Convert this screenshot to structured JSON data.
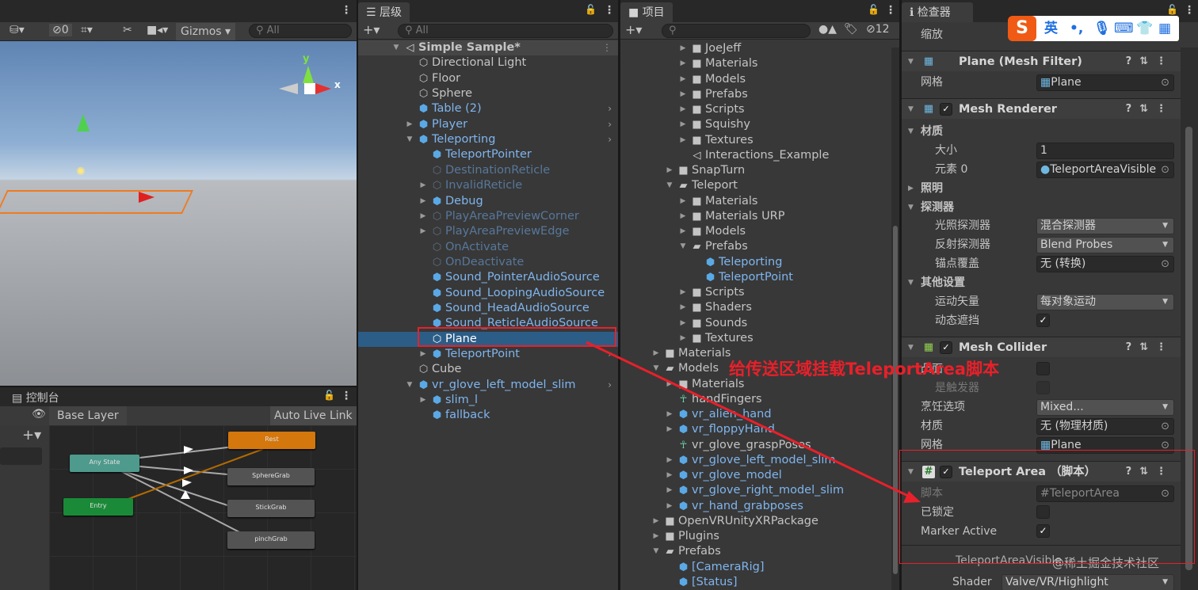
{
  "scene": {
    "hidden_count": "0",
    "gizmos": "Gizmos",
    "search_placeholder": "All",
    "axis_x": "x",
    "axis_y": "y"
  },
  "hierarchy": {
    "tab": "层级",
    "search_placeholder": "All",
    "rows": [
      {
        "label": "Simple Sample*",
        "depth": 0,
        "arrow": "down",
        "type": "scene",
        "bold": true,
        "menu": true
      },
      {
        "label": "Directional Light",
        "depth": 1,
        "type": "go"
      },
      {
        "label": "Floor",
        "depth": 1,
        "type": "go"
      },
      {
        "label": "Sphere",
        "depth": 1,
        "type": "go"
      },
      {
        "label": "Table (2)",
        "depth": 1,
        "type": "prefab",
        "chev": true
      },
      {
        "label": "Player",
        "depth": 1,
        "arrow": "right",
        "type": "prefab",
        "chev": true
      },
      {
        "label": "Teleporting",
        "depth": 1,
        "arrow": "down",
        "type": "prefab",
        "chev": true
      },
      {
        "label": "TeleportPointer",
        "depth": 2,
        "type": "prefab"
      },
      {
        "label": "DestinationReticle",
        "depth": 2,
        "type": "inactive"
      },
      {
        "label": "InvalidReticle",
        "depth": 2,
        "arrow": "right",
        "type": "inactive"
      },
      {
        "label": "Debug",
        "depth": 2,
        "arrow": "right",
        "type": "prefab"
      },
      {
        "label": "PlayAreaPreviewCorner",
        "depth": 2,
        "arrow": "right",
        "type": "inactive"
      },
      {
        "label": "PlayAreaPreviewEdge",
        "depth": 2,
        "arrow": "right",
        "type": "inactive"
      },
      {
        "label": "OnActivate",
        "depth": 2,
        "type": "inactive"
      },
      {
        "label": "OnDeactivate",
        "depth": 2,
        "type": "inactive"
      },
      {
        "label": "Sound_PointerAudioSource",
        "depth": 2,
        "type": "prefab"
      },
      {
        "label": "Sound_LoopingAudioSource",
        "depth": 2,
        "type": "prefab"
      },
      {
        "label": "Sound_HeadAudioSource",
        "depth": 2,
        "type": "prefab"
      },
      {
        "label": "Sound_ReticleAudioSource",
        "depth": 2,
        "type": "prefab"
      },
      {
        "label": "Plane",
        "depth": 2,
        "type": "selected"
      },
      {
        "label": "TeleportPoint",
        "depth": 2,
        "arrow": "right",
        "type": "prefab",
        "chev": true
      },
      {
        "label": "Cube",
        "depth": 1,
        "type": "go"
      },
      {
        "label": "vr_glove_left_model_slim",
        "depth": 1,
        "arrow": "down",
        "type": "prefab",
        "chev": true
      },
      {
        "label": "slim_l",
        "depth": 2,
        "arrow": "right",
        "type": "prefab"
      },
      {
        "label": "fallback",
        "depth": 2,
        "type": "prefab"
      }
    ]
  },
  "project": {
    "tab": "项目",
    "hidden_count": "12",
    "rows": [
      {
        "label": "JoeJeff",
        "depth": 3,
        "arrow": "right",
        "type": "folder"
      },
      {
        "label": "Materials",
        "depth": 3,
        "arrow": "right",
        "type": "folder"
      },
      {
        "label": "Models",
        "depth": 3,
        "arrow": "right",
        "type": "folder"
      },
      {
        "label": "Prefabs",
        "depth": 3,
        "arrow": "right",
        "type": "folder"
      },
      {
        "label": "Scripts",
        "depth": 3,
        "arrow": "right",
        "type": "folder"
      },
      {
        "label": "Squishy",
        "depth": 3,
        "arrow": "right",
        "type": "folder"
      },
      {
        "label": "Textures",
        "depth": 3,
        "arrow": "right",
        "type": "folder"
      },
      {
        "label": "Interactions_Example",
        "depth": 3,
        "type": "scene"
      },
      {
        "label": "SnapTurn",
        "depth": 2,
        "arrow": "right",
        "type": "folder"
      },
      {
        "label": "Teleport",
        "depth": 2,
        "arrow": "down",
        "type": "folder-open"
      },
      {
        "label": "Materials",
        "depth": 3,
        "arrow": "right",
        "type": "folder"
      },
      {
        "label": "Materials URP",
        "depth": 3,
        "arrow": "right",
        "type": "folder"
      },
      {
        "label": "Models",
        "depth": 3,
        "arrow": "right",
        "type": "folder"
      },
      {
        "label": "Prefabs",
        "depth": 3,
        "arrow": "down",
        "type": "folder-open"
      },
      {
        "label": "Teleporting",
        "depth": 4,
        "type": "prefab"
      },
      {
        "label": "TeleportPoint",
        "depth": 4,
        "type": "prefab"
      },
      {
        "label": "Scripts",
        "depth": 3,
        "arrow": "right",
        "type": "folder"
      },
      {
        "label": "Shaders",
        "depth": 3,
        "arrow": "right",
        "type": "folder"
      },
      {
        "label": "Sounds",
        "depth": 3,
        "arrow": "right",
        "type": "folder"
      },
      {
        "label": "Textures",
        "depth": 3,
        "arrow": "right",
        "type": "folder"
      },
      {
        "label": "Materials",
        "depth": 1,
        "arrow": "right",
        "type": "folder"
      },
      {
        "label": "Models",
        "depth": 1,
        "arrow": "down",
        "type": "folder-open"
      },
      {
        "label": "Materials",
        "depth": 2,
        "arrow": "right",
        "type": "folder"
      },
      {
        "label": "handFingers",
        "depth": 2,
        "type": "avatar"
      },
      {
        "label": "vr_alien_hand",
        "depth": 2,
        "arrow": "right",
        "type": "prefab"
      },
      {
        "label": "vr_floppyHand",
        "depth": 2,
        "arrow": "right",
        "type": "prefab"
      },
      {
        "label": "vr_glove_graspPoses",
        "depth": 2,
        "type": "avatar"
      },
      {
        "label": "vr_glove_left_model_slim",
        "depth": 2,
        "arrow": "right",
        "type": "prefab"
      },
      {
        "label": "vr_glove_model",
        "depth": 2,
        "arrow": "right",
        "type": "prefab"
      },
      {
        "label": "vr_glove_right_model_slim",
        "depth": 2,
        "arrow": "right",
        "type": "prefab"
      },
      {
        "label": "vr_hand_grabposes",
        "depth": 2,
        "arrow": "right",
        "type": "prefab"
      },
      {
        "label": "OpenVRUnityXRPackage",
        "depth": 1,
        "arrow": "right",
        "type": "folder"
      },
      {
        "label": "Plugins",
        "depth": 1,
        "arrow": "right",
        "type": "folder"
      },
      {
        "label": "Prefabs",
        "depth": 1,
        "arrow": "down",
        "type": "folder-open"
      },
      {
        "label": "[CameraRig]",
        "depth": 2,
        "type": "prefab"
      },
      {
        "label": "[Status]",
        "depth": 2,
        "type": "prefab"
      }
    ]
  },
  "animator": {
    "tab": "控制台",
    "layer": "Base Layer",
    "live_link": "Auto Live Link",
    "nodes": {
      "rest": "Rest",
      "any_state": "Any State",
      "entry": "Entry",
      "sphere_grab": "SphereGrab",
      "stick_grab": "StickGrab",
      "pinch_grab": "pinchGrab"
    }
  },
  "inspector": {
    "tab": "检查器",
    "ime_lang": "英",
    "scale_label": "缩放",
    "mesh_filter": {
      "title": "Plane (Mesh Filter)",
      "mesh_label": "网格",
      "mesh_value": "Plane"
    },
    "mesh_renderer": {
      "title": "Mesh Renderer",
      "materials": "材质",
      "size_label": "大小",
      "size_value": "1",
      "element_label": "元素 0",
      "element_value": "TeleportAreaVisible",
      "lighting": "照明",
      "probes": "探测器",
      "light_probes_label": "光照探测器",
      "light_probes_value": "混合探测器",
      "reflection_label": "反射探测器",
      "reflection_value": "Blend Probes",
      "anchor_label": "锚点覆盖",
      "anchor_value": "无 (转换)",
      "other": "其他设置",
      "motion_label": "运动矢量",
      "motion_value": "每对象运动",
      "occlusion_label": "动态遮挡",
      "occlusion_checked": true
    },
    "mesh_collider": {
      "title": "Mesh Collider",
      "convex_label": "凸面",
      "trigger_label": "是触发器",
      "cooking_label": "烹饪选项",
      "cooking_value": "Mixed...",
      "material_label": "材质",
      "material_value": "无 (物理材质)",
      "mesh_label": "网格",
      "mesh_value": "Plane"
    },
    "teleport_area": {
      "title": "Teleport Area （脚本）",
      "script_label": "脚本",
      "script_value": "TeleportArea",
      "locked_label": "已锁定",
      "locked": false,
      "marker_label": "Marker Active",
      "marker_active": true
    },
    "material": {
      "title": "TeleportAreaVisible",
      "shader_label": "Shader",
      "shader_value": "Valve/VR/Highlight"
    }
  },
  "annotation": {
    "text": "给传送区域挂载TeleportArea脚本",
    "color": "#e8202a"
  },
  "watermark": "@稀土掘金技术社区"
}
